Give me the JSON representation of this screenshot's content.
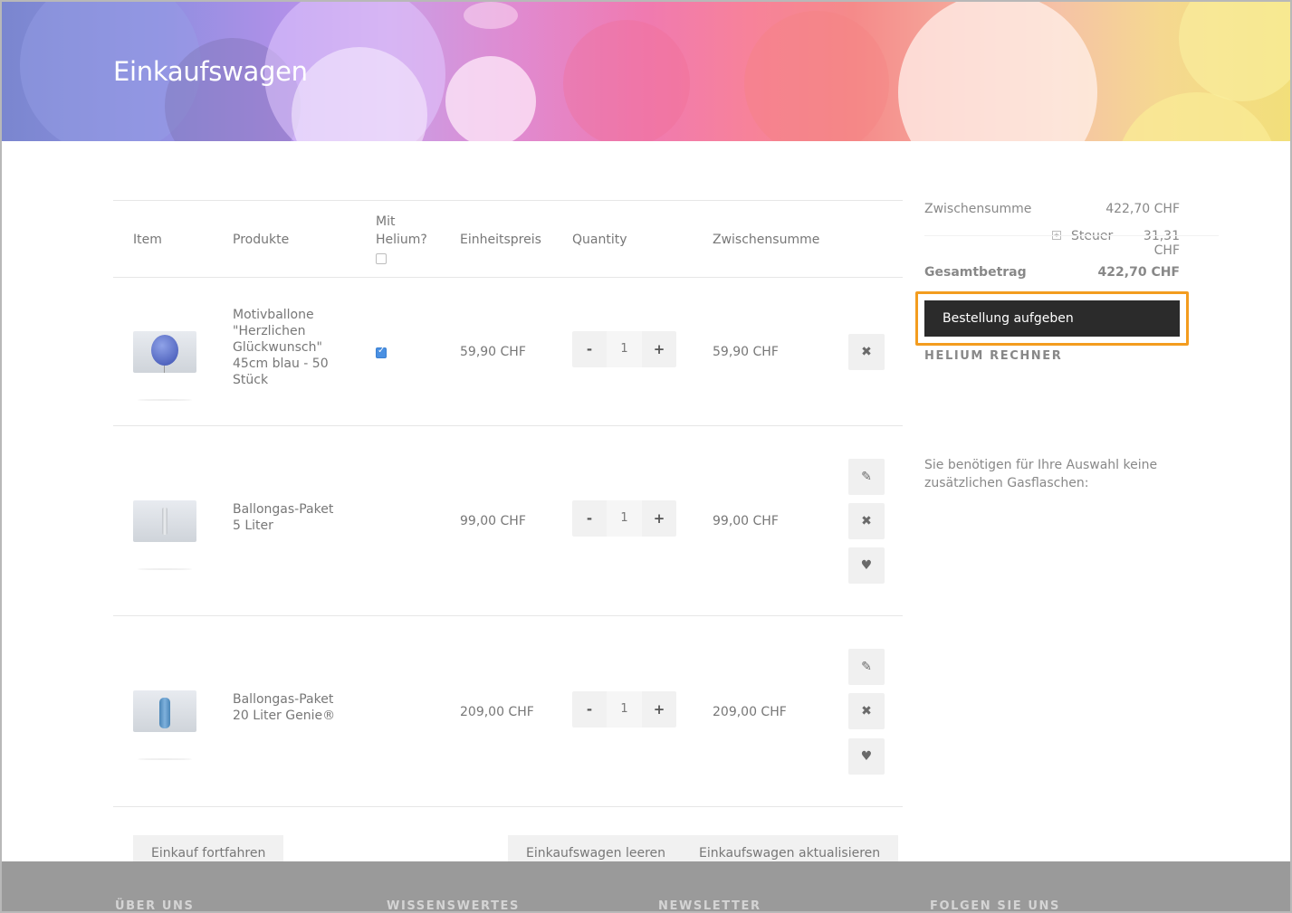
{
  "page": {
    "title": "Einkaufswagen"
  },
  "cart": {
    "headers": {
      "item": "Item",
      "produkte": "Produkte",
      "mit_helium": "Mit Helium?",
      "einheitspreis": "Einheitspreis",
      "quantity": "Quantity",
      "zwischensumme": "Zwischensumme"
    },
    "items": [
      {
        "name": "Motivballone \"Herzlichen Glückwunsch\" 45cm blau - 50 Stück",
        "helium_checked": true,
        "unit_price": "59,90 CHF",
        "qty": "1",
        "subtotal": "59,90 CHF"
      },
      {
        "name": "Ballongas-Paket 5 Liter",
        "unit_price": "99,00 CHF",
        "qty": "1",
        "subtotal": "99,00 CHF"
      },
      {
        "name": "Ballongas-Paket 20 Liter Genie®",
        "unit_price": "209,00 CHF",
        "qty": "1",
        "subtotal": "209,00 CHF"
      }
    ],
    "qty_minus": "-",
    "qty_plus": "+",
    "icons": {
      "remove": "close-icon",
      "edit": "pencil-icon",
      "wishlist": "heart-icon",
      "helium_checkbox": "checkbox-icon"
    }
  },
  "actions": {
    "continue": "Einkauf fortfahren",
    "clear": "Einkaufswagen leeren",
    "update": "Einkaufswagen aktualisieren"
  },
  "summary": {
    "subtotal_label": "Zwischensumme",
    "subtotal_value": "422,70 CHF",
    "tax_label": "Steuer",
    "tax_value": "31,31 CHF",
    "total_label": "Gesamtbetrag",
    "total_value": "422,70 CHF",
    "checkout_label": "Bestellung aufgeben",
    "helium_title": "HELIUM RECHNER",
    "helium_note": "Sie benötigen für Ihre Auswahl keine zusätzlichen Gasflaschen:"
  },
  "footer": {
    "col1": "ÜBER UNS",
    "col2": "WISSENSWERTES",
    "col3": "NEWSLETTER",
    "col4": "FOLGEN SIE UNS"
  },
  "colors": {
    "highlight": "#f39c1f",
    "checkout_bg": "#2b2b2b",
    "footer_bg": "#9a9a9a"
  }
}
